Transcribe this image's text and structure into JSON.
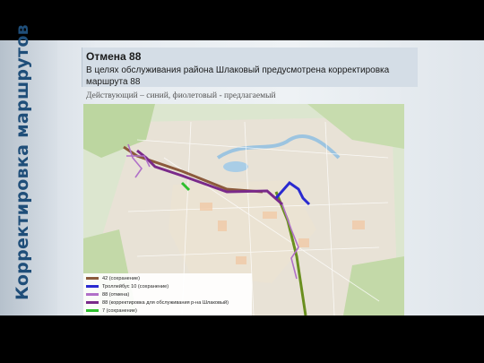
{
  "slide": {
    "side_title": "Корректировка маршрутов",
    "title": "Отмена 88",
    "description": "В целях обслуживания района Шлаковый предусмотрена корректировка маршрута 88",
    "caption": "Действующий – синий, фиолетовый - предлагаемый"
  },
  "legend": [
    {
      "label": "42 (сохранение)",
      "color": "#8b5a3c"
    },
    {
      "label": "Троллейбус 10 (сохранение)",
      "color": "#2a2ad0"
    },
    {
      "label": "88 (отмена)",
      "color": "#b070c8"
    },
    {
      "label": "88 (корректировка для обслуживания р-на Шлаковый)",
      "color": "#7a2a8a"
    },
    {
      "label": "7 (сохранение)",
      "color": "#2ebf2e"
    }
  ],
  "colors": {
    "title_color": "#1f4e79",
    "route_42": "#8b5a3c",
    "trolleybus_10": "#2a2ad0",
    "route_88_cancel": "#b070c8",
    "route_88_new": "#7a2a8a",
    "route_7": "#2ebf2e"
  }
}
